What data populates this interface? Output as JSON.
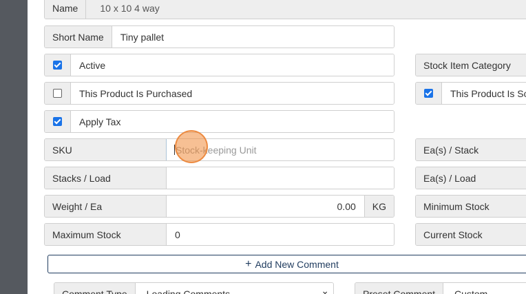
{
  "product": {
    "name": {
      "label": "Name",
      "value": "10 x 10 4 way"
    },
    "short_name": {
      "label": "Short Name",
      "value": "Tiny pallet"
    },
    "active": {
      "label": "Active",
      "checked": true
    },
    "purchased": {
      "label": "This Product Is Purchased",
      "checked": false
    },
    "apply_tax": {
      "label": "Apply Tax",
      "checked": true
    },
    "sku": {
      "label": "SKU",
      "placeholder": "Stock-keeping Unit",
      "value": ""
    },
    "stacks_load": {
      "label": "Stacks / Load",
      "value": ""
    },
    "weight": {
      "label": "Weight / Ea",
      "value": "0.00",
      "unit": "KG"
    },
    "max_stock": {
      "label": "Maximum Stock",
      "value": "0"
    },
    "category": {
      "label": "Stock Item Category"
    },
    "sold": {
      "label": "This Product Is Sold",
      "checked": true
    },
    "ea_stack": {
      "label": "Ea(s) / Stack"
    },
    "ea_load": {
      "label": "Ea(s) / Load"
    },
    "min_stock": {
      "label": "Minimum Stock"
    },
    "current_stock": {
      "label": "Current Stock"
    }
  },
  "comments": {
    "add_button": "Add New Comment",
    "add_icon": "plus-icon",
    "comment_type": {
      "label": "Comment Type",
      "value": "Loading Comments"
    },
    "preset_comment": {
      "label": "Preset Comment",
      "value": "Custom"
    }
  },
  "colors": {
    "accent": "#1a73e8",
    "button_outline": "#1f3b5e",
    "focus": "#66afe9",
    "click_marker": "#f08c3c"
  }
}
